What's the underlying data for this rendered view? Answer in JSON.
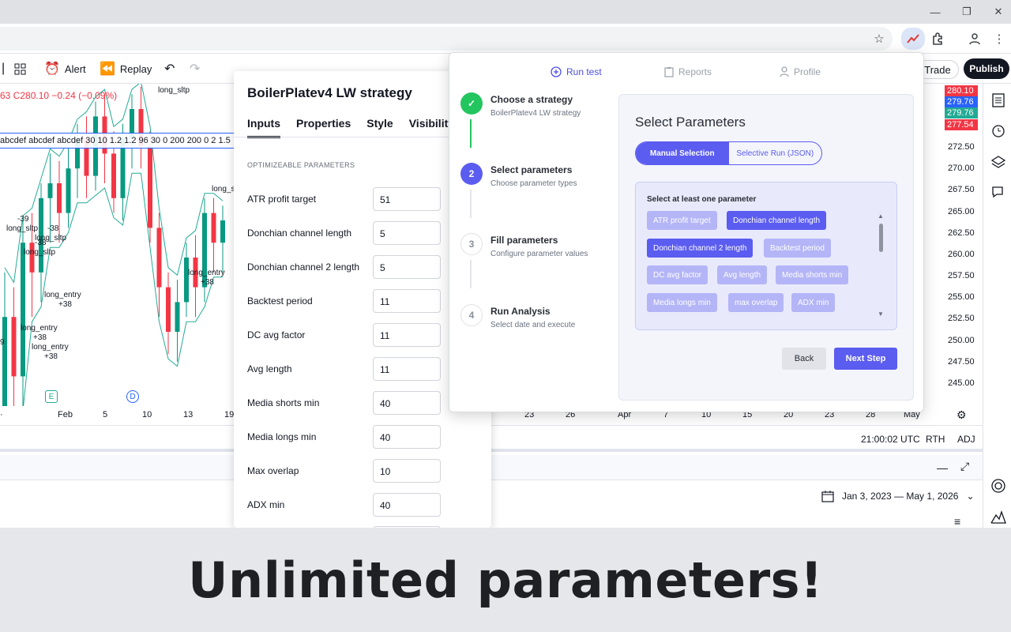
{
  "browser": {
    "window_controls": {
      "minimize": "—",
      "restore": "❐",
      "close": "✕"
    }
  },
  "toolbar": {
    "alert_label": "Alert",
    "replay_label": "Replay",
    "trade_label": "Trade",
    "publish_label": "Publish"
  },
  "chart": {
    "legend": "63 C280.10 −0.24 (−0.09%)",
    "indicator_strip": "abcdef abcdef abcdef 30 10 1.2 1.2 96 30 0 200 200 0 2 1.5",
    "annotations": [
      "long_sltp",
      "long_s",
      "-39",
      "long_sltp",
      "-38",
      "-38",
      "long_sltp",
      "long_sltp",
      "long_entry",
      "+38",
      "long_entry",
      "+38",
      "long_entry",
      "+38",
      "long_entry",
      "+38",
      "9"
    ],
    "event_markers": {
      "earnings": "E",
      "dividend": "D"
    },
    "price_tags": [
      {
        "value": "280.10",
        "color": "#f23645"
      },
      {
        "value": "279.76",
        "color": "#2962ff"
      },
      {
        "value": "279.76",
        "color": "#22ab94"
      },
      {
        "value": "277.54",
        "color": "#f23645"
      }
    ],
    "price_labels": [
      "272.50",
      "270.00",
      "267.50",
      "265.00",
      "262.50",
      "260.00",
      "257.50",
      "255.00",
      "252.50",
      "250.00",
      "247.50",
      "245.00"
    ],
    "time_labels": [
      "Feb",
      "5",
      "10",
      "13",
      "19",
      "23",
      "26",
      "Apr",
      "7",
      "10",
      "15",
      "20",
      "23",
      "28",
      "May"
    ],
    "candles": [
      [
        232,
        252,
        224,
        258
      ],
      [
        252,
        244,
        238,
        256
      ],
      [
        244,
        262,
        240,
        265
      ],
      [
        262,
        258,
        252,
        266
      ],
      [
        258,
        268,
        254,
        270
      ],
      [
        268,
        270,
        262,
        274
      ],
      [
        270,
        266,
        262,
        273
      ],
      [
        266,
        272,
        264,
        275
      ],
      [
        272,
        276,
        268,
        278
      ],
      [
        276,
        271,
        268,
        279
      ],
      [
        271,
        279,
        269,
        281
      ],
      [
        279,
        274,
        270,
        282
      ],
      [
        274,
        268,
        266,
        277
      ],
      [
        268,
        276,
        265,
        278
      ],
      [
        276,
        280,
        272,
        282
      ],
      [
        280,
        275,
        272,
        283
      ],
      [
        275,
        264,
        262,
        277
      ],
      [
        264,
        256,
        252,
        266
      ],
      [
        256,
        250,
        247,
        258
      ],
      [
        250,
        254,
        246,
        257
      ],
      [
        254,
        260,
        252,
        262
      ],
      [
        260,
        256,
        252,
        263
      ],
      [
        256,
        266,
        254,
        268
      ],
      [
        266,
        262,
        258,
        268
      ],
      [
        262,
        265,
        258,
        267
      ]
    ]
  },
  "status": {
    "time": "21:00:02 UTC",
    "rth": "RTH",
    "adj": "ADJ"
  },
  "bottom_panel": {
    "date_range": "Jan 3, 2023 — May 1, 2026"
  },
  "strategy_dialog": {
    "title": "BoilerPlatev4 LW strategy",
    "tabs": [
      "Inputs",
      "Properties",
      "Style",
      "Visibility"
    ],
    "section_label": "OPTIMIZEABLE PARAMETERS",
    "params": [
      {
        "label": "ATR profit target",
        "value": "51"
      },
      {
        "label": "Donchian channel length",
        "value": "5"
      },
      {
        "label": "Donchian channel 2 length",
        "value": "5"
      },
      {
        "label": "Backtest period",
        "value": "11"
      },
      {
        "label": "DC avg factor",
        "value": "11"
      },
      {
        "label": "Avg length",
        "value": "11"
      },
      {
        "label": "Media shorts min",
        "value": "40"
      },
      {
        "label": "Media longs min",
        "value": "40"
      },
      {
        "label": "Max overlap",
        "value": "10"
      },
      {
        "label": "ADX min",
        "value": "40"
      }
    ]
  },
  "extension": {
    "nav": [
      {
        "label": "Run test",
        "icon": "plus-circle-icon",
        "active": true
      },
      {
        "label": "Reports",
        "icon": "clipboard-icon",
        "active": false
      },
      {
        "label": "Profile",
        "icon": "user-icon",
        "active": false
      }
    ],
    "steps": [
      {
        "number": "✓",
        "title": "Choose a strategy",
        "subtitle": "BoilerPlatev4 LW strategy",
        "state": "done"
      },
      {
        "number": "2",
        "title": "Select parameters",
        "subtitle": "Choose parameter types",
        "state": "active"
      },
      {
        "number": "3",
        "title": "Fill parameters",
        "subtitle": "Configure parameter values",
        "state": "pending"
      },
      {
        "number": "4",
        "title": "Run Analysis",
        "subtitle": "Select date and execute",
        "state": "pending"
      }
    ],
    "panel": {
      "title": "Select Parameters",
      "mode_options": [
        "Manual Selection",
        "Selective Run (JSON)"
      ],
      "box_label": "Select at least one parameter",
      "chips": [
        {
          "label": "ATR profit target",
          "selected": false
        },
        {
          "label": "Donchian channel length",
          "selected": true
        },
        {
          "label": "Donchian channel 2 length",
          "selected": true
        },
        {
          "label": "Backtest period",
          "selected": false
        },
        {
          "label": "DC avg factor",
          "selected": false
        },
        {
          "label": "Avg length",
          "selected": false
        },
        {
          "label": "Media shorts min",
          "selected": false
        },
        {
          "label": "Media longs min",
          "selected": false
        },
        {
          "label": "max overlap",
          "selected": false
        },
        {
          "label": "ADX min",
          "selected": false
        }
      ],
      "back_label": "Back",
      "next_label": "Next Step"
    }
  },
  "caption": "Unlimited parameters!",
  "colors": {
    "accent": "#5b5cf0",
    "accent_light": "#b4b5f7",
    "step_done": "#22c55e",
    "candle_up": "#089981",
    "candle_down": "#f23645"
  }
}
